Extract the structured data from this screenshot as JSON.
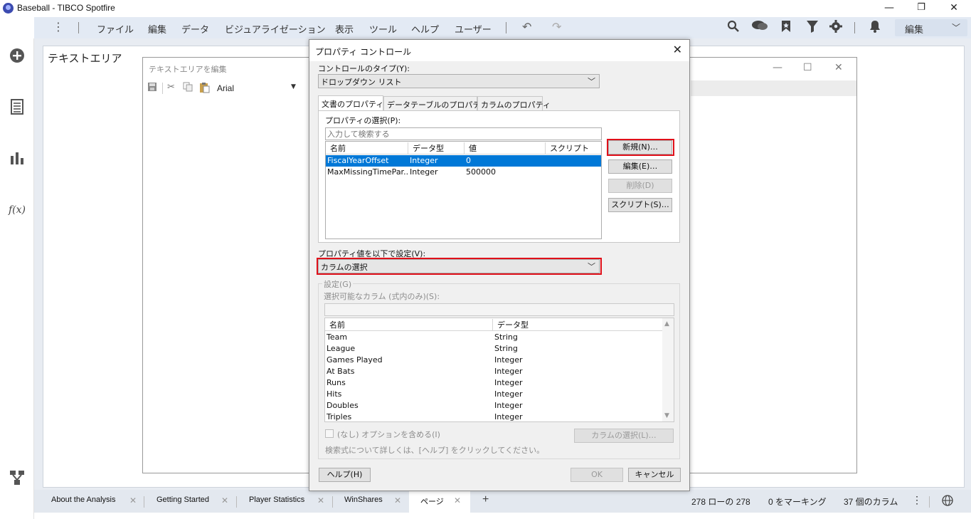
{
  "window": {
    "title": "Baseball - TIBCO Spotfire",
    "minimize": "—",
    "restore": "❐",
    "close": "✕"
  },
  "toolbar": {
    "menus": [
      "ファイル",
      "編集",
      "データ",
      "ビジュアライゼーション",
      "表示",
      "ツール",
      "ヘルプ",
      "ユーザー"
    ],
    "edit_dropdown": "編集"
  },
  "canvas": {
    "text_area_title": "テキストエリア"
  },
  "edit_text_window": {
    "title": "テキストエリアを編集",
    "font": "Arial"
  },
  "dialog": {
    "title": "プロパティ コントロール",
    "control_type_label": "コントロールのタイプ(Y):",
    "control_type_value": "ドロップダウン リスト",
    "tabs": [
      "文書のプロパティ",
      "データテーブルのプロパティ",
      "カラムのプロパティ"
    ],
    "select_property_label": "プロパティの選択(P):",
    "search_placeholder": "入力して検索する",
    "property_columns": [
      "名前",
      "データ型",
      "値",
      "スクリプト"
    ],
    "properties": [
      {
        "name": "FiscalYearOffset",
        "type": "Integer",
        "value": "0",
        "script": ""
      },
      {
        "name": "MaxMissingTimePar...",
        "type": "Integer",
        "value": "500000",
        "script": ""
      }
    ],
    "buttons": {
      "new": "新規(N)…",
      "edit": "編集(E)…",
      "delete": "削除(D)",
      "script": "スクリプト(S)…"
    },
    "set_value_label": "プロパティ値を以下で設定(V):",
    "set_value_value": "カラムの選択",
    "settings_group": "設定(G)",
    "selectable_columns_label": "選択可能なカラム (式内のみ)(S):",
    "column_headers": [
      "名前",
      "データ型"
    ],
    "columns": [
      {
        "name": "Team",
        "type": "String"
      },
      {
        "name": "League",
        "type": "String"
      },
      {
        "name": "Games Played",
        "type": "Integer"
      },
      {
        "name": "At Bats",
        "type": "Integer"
      },
      {
        "name": "Runs",
        "type": "Integer"
      },
      {
        "name": "Hits",
        "type": "Integer"
      },
      {
        "name": "Doubles",
        "type": "Integer"
      },
      {
        "name": "Triples",
        "type": "Integer"
      }
    ],
    "include_none_label": "(なし) オプションを含める(I)",
    "select_columns_button": "カラムの選択(L)…",
    "help_text": "検索式について詳しくは、[ヘルプ] をクリックしてください。",
    "help_button": "ヘルプ(H)",
    "ok_button": "OK",
    "cancel_button": "キャンセル"
  },
  "page_tabs": [
    {
      "label": "About the Analysis",
      "active": false
    },
    {
      "label": "Getting Started",
      "active": false
    },
    {
      "label": "Player Statistics",
      "active": false
    },
    {
      "label": "WinShares",
      "active": false
    },
    {
      "label": "ページ",
      "active": true
    }
  ],
  "add_page": "+",
  "status": {
    "rows": "278 ローの 278",
    "marked": "0 をマーキング",
    "columns": "37 個のカラム"
  },
  "colors": {
    "highlight": "#e0101a",
    "selection": "#0078d7",
    "toolbar_bg": "#e3eaf4"
  }
}
